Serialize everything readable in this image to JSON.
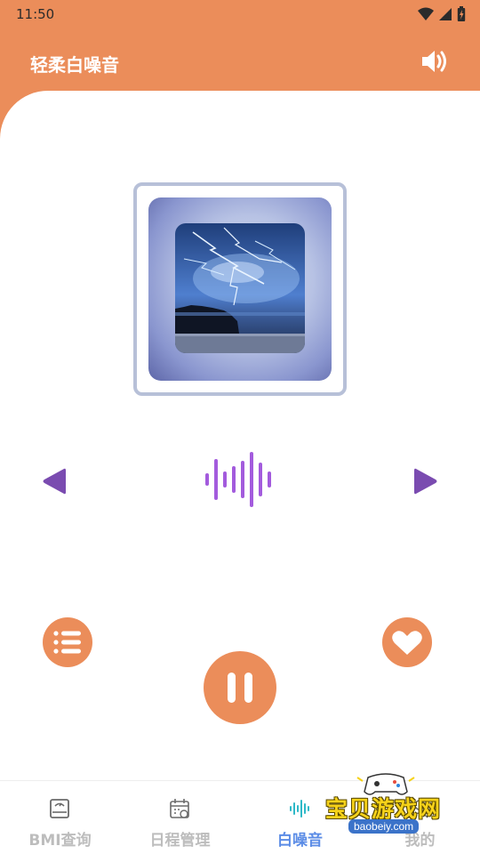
{
  "status_bar": {
    "time": "11:50",
    "icons": [
      "wifi-icon",
      "signal-icon",
      "battery-icon"
    ]
  },
  "header": {
    "title": "轻柔白噪音",
    "volume_icon": "volume-icon"
  },
  "player": {
    "album_art": "lightning-storm-over-lake",
    "controls": [
      "previous-icon",
      "waveform-icon",
      "next-icon"
    ],
    "state": "playing"
  },
  "bottom_nav": {
    "items": [
      {
        "label": "BMI查询",
        "icon": "scale-icon",
        "active": false
      },
      {
        "label": "日程管理",
        "icon": "calendar-icon",
        "active": false
      },
      {
        "label": "白噪音",
        "icon": "waveform-icon",
        "active": true
      },
      {
        "label": "我的",
        "icon": "user-icon",
        "active": false
      }
    ]
  },
  "watermark": {
    "text": "宝贝游戏网",
    "url": "baobeiy.com"
  },
  "colors": {
    "accent": "#EB8D5A",
    "purple": "#7A4BB0",
    "wave": "#A35BDD",
    "nav_active": "#5B8CE6",
    "nav_inactive": "#BDBDBD"
  }
}
